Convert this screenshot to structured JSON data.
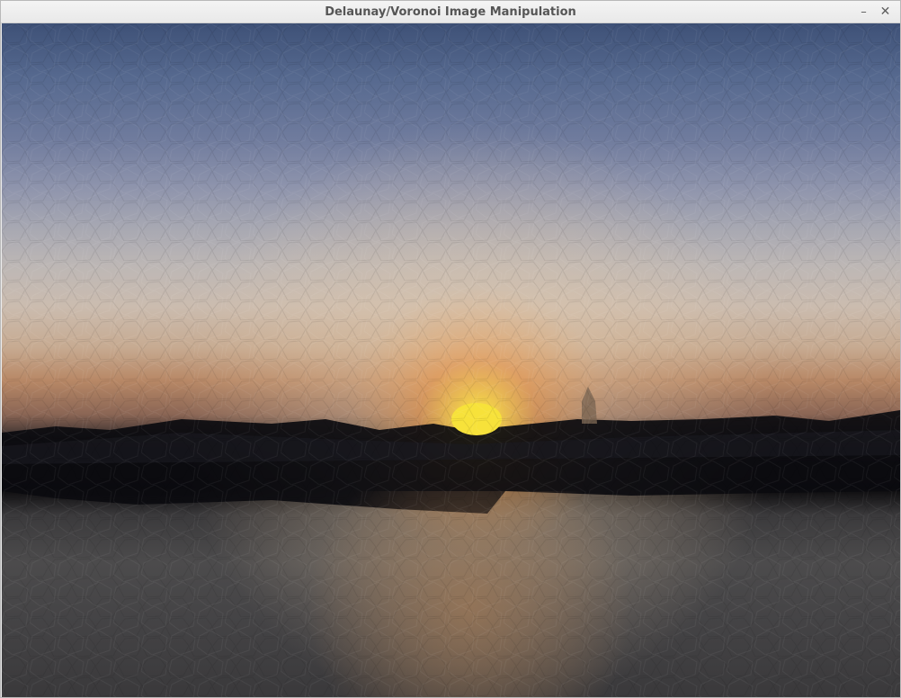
{
  "window": {
    "title": "Delaunay/Voronoi Image Manipulation",
    "minimize_glyph": "–",
    "close_glyph": "✕"
  },
  "canvas": {
    "description_icon": "voronoi-mosaic-image",
    "colors": {
      "sky_top": "#3e5177",
      "sky_mid": "#8d93ac",
      "glow": "#cbbcaf",
      "sun": "#f7e23a",
      "horizon": "#0b0a0c",
      "foreground": "#4c4b4c"
    }
  }
}
